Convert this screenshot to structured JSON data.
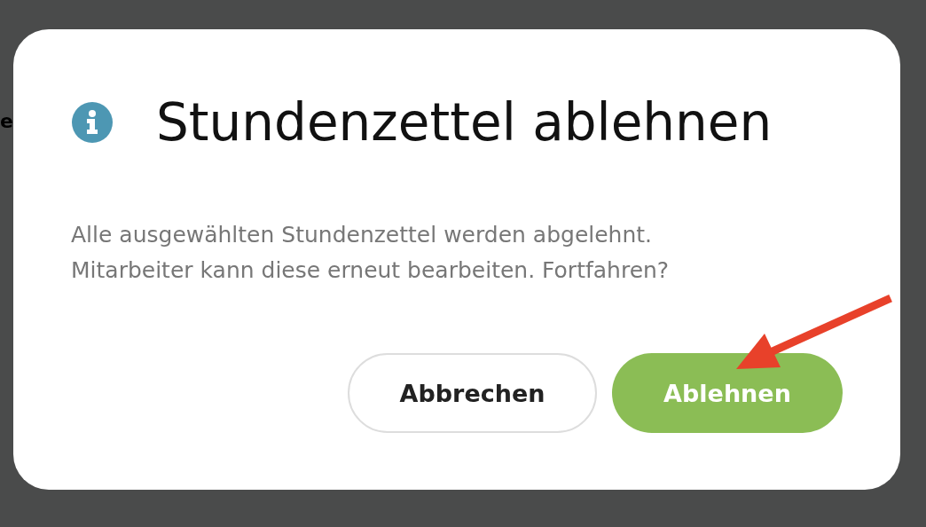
{
  "background_text": "e",
  "dialog": {
    "title": "Stundenzettel ablehnen",
    "message_lines": [
      "Alle ausgewählten Stundenzettel werden abgelehnt.",
      "Mitarbeiter kann diese erneut bearbeiten. Fortfahren?"
    ],
    "buttons": [
      {
        "label": "Abbrechen",
        "kind": "secondary"
      },
      {
        "label": "Ablehnen",
        "kind": "primary"
      }
    ]
  }
}
